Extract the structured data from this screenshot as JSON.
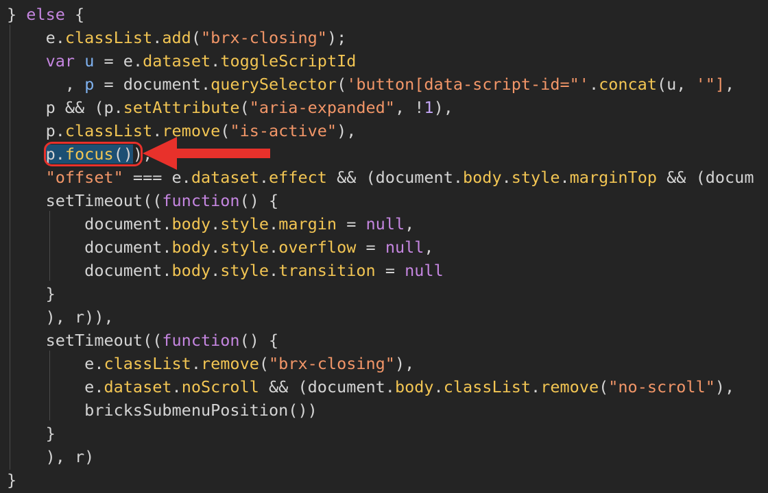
{
  "editor": {
    "lines": [
      [
        [
          "} ",
          "plain"
        ],
        [
          "else",
          "kw"
        ],
        [
          " {",
          "plain"
        ]
      ],
      [
        [
          "    e.",
          "plain"
        ],
        [
          "classList",
          "prop"
        ],
        [
          ".",
          "plain"
        ],
        [
          "add",
          "prop"
        ],
        [
          "(",
          "plain"
        ],
        [
          "\"brx-closing\"",
          "str"
        ],
        [
          ");",
          "plain"
        ]
      ],
      [
        [
          "    ",
          "plain"
        ],
        [
          "var",
          "kw"
        ],
        [
          " ",
          "plain"
        ],
        [
          "u",
          "var"
        ],
        [
          " = e.",
          "plain"
        ],
        [
          "dataset",
          "prop"
        ],
        [
          ".",
          "plain"
        ],
        [
          "toggleScriptId",
          "prop"
        ]
      ],
      [
        [
          "      , ",
          "plain"
        ],
        [
          "p",
          "var"
        ],
        [
          " = document.",
          "plain"
        ],
        [
          "querySelector",
          "prop"
        ],
        [
          "(",
          "plain"
        ],
        [
          "'button[data-script-id=\"'",
          "str"
        ],
        [
          ".",
          "plain"
        ],
        [
          "concat",
          "prop"
        ],
        [
          "(u, ",
          "plain"
        ],
        [
          "'\"]",
          "str"
        ],
        [
          ",",
          "plain"
        ]
      ],
      [
        [
          "    p && (p.",
          "plain"
        ],
        [
          "setAttribute",
          "prop"
        ],
        [
          "(",
          "plain"
        ],
        [
          "\"aria-expanded\"",
          "str"
        ],
        [
          ", !",
          "plain"
        ],
        [
          "1",
          "num"
        ],
        [
          "),",
          "plain"
        ]
      ],
      [
        [
          "    p.",
          "plain"
        ],
        [
          "classList",
          "prop"
        ],
        [
          ".",
          "plain"
        ],
        [
          "remove",
          "prop"
        ],
        [
          "(",
          "plain"
        ],
        [
          "\"is-active\"",
          "str"
        ],
        [
          "),",
          "plain"
        ]
      ],
      [
        [
          "    ",
          "plain"
        ],
        [
          "p.",
          "plain sel"
        ],
        [
          "focus",
          "prop sel"
        ],
        [
          "()",
          "plain sel"
        ],
        [
          "),",
          "plain"
        ]
      ],
      [
        [
          "    ",
          "plain"
        ],
        [
          "\"offset\"",
          "str"
        ],
        [
          " === e.",
          "plain"
        ],
        [
          "dataset",
          "prop"
        ],
        [
          ".",
          "plain"
        ],
        [
          "effect",
          "prop"
        ],
        [
          " && (document.",
          "plain"
        ],
        [
          "body",
          "prop"
        ],
        [
          ".",
          "plain"
        ],
        [
          "style",
          "prop"
        ],
        [
          ".",
          "plain"
        ],
        [
          "marginTop",
          "prop"
        ],
        [
          " && (docum",
          "plain"
        ]
      ],
      [
        [
          "    setTimeout((",
          "plain"
        ],
        [
          "function",
          "kw"
        ],
        [
          "() {",
          "plain"
        ]
      ],
      [
        [
          "        document.",
          "plain"
        ],
        [
          "body",
          "prop"
        ],
        [
          ".",
          "plain"
        ],
        [
          "style",
          "prop"
        ],
        [
          ".",
          "plain"
        ],
        [
          "margin",
          "prop"
        ],
        [
          " = ",
          "plain"
        ],
        [
          "null",
          "kw"
        ],
        [
          ",",
          "plain"
        ]
      ],
      [
        [
          "        document.",
          "plain"
        ],
        [
          "body",
          "prop"
        ],
        [
          ".",
          "plain"
        ],
        [
          "style",
          "prop"
        ],
        [
          ".",
          "plain"
        ],
        [
          "overflow",
          "prop"
        ],
        [
          " = ",
          "plain"
        ],
        [
          "null",
          "kw"
        ],
        [
          ",",
          "plain"
        ]
      ],
      [
        [
          "        document.",
          "plain"
        ],
        [
          "body",
          "prop"
        ],
        [
          ".",
          "plain"
        ],
        [
          "style",
          "prop"
        ],
        [
          ".",
          "plain"
        ],
        [
          "transition",
          "prop"
        ],
        [
          " = ",
          "plain"
        ],
        [
          "null",
          "kw"
        ]
      ],
      [
        [
          "    }",
          "plain"
        ]
      ],
      [
        [
          "    ), r)),",
          "plain"
        ]
      ],
      [
        [
          "    setTimeout((",
          "plain"
        ],
        [
          "function",
          "kw"
        ],
        [
          "() {",
          "plain"
        ]
      ],
      [
        [
          "        e.",
          "plain"
        ],
        [
          "classList",
          "prop"
        ],
        [
          ".",
          "plain"
        ],
        [
          "remove",
          "prop"
        ],
        [
          "(",
          "plain"
        ],
        [
          "\"brx-closing\"",
          "str"
        ],
        [
          "),",
          "plain"
        ]
      ],
      [
        [
          "        e.",
          "plain"
        ],
        [
          "dataset",
          "prop"
        ],
        [
          ".",
          "plain"
        ],
        [
          "noScroll",
          "prop"
        ],
        [
          " && (document.",
          "plain"
        ],
        [
          "body",
          "prop"
        ],
        [
          ".",
          "plain"
        ],
        [
          "classList",
          "prop"
        ],
        [
          ".",
          "plain"
        ],
        [
          "remove",
          "prop"
        ],
        [
          "(",
          "plain"
        ],
        [
          "\"no-scroll\"",
          "str"
        ],
        [
          "),",
          "plain"
        ]
      ],
      [
        [
          "        bricksSubmenuPosition())",
          "plain"
        ]
      ],
      [
        [
          "    }",
          "plain"
        ]
      ],
      [
        [
          "    ), r)",
          "plain"
        ]
      ],
      [
        [
          "}",
          "plain"
        ]
      ]
    ],
    "colors": {
      "background": "#242424",
      "keyword": "#c586e0",
      "property": "#f2c553",
      "string": "#f29668",
      "selection": "#1c4f73",
      "annotation": "#e8312b"
    }
  }
}
